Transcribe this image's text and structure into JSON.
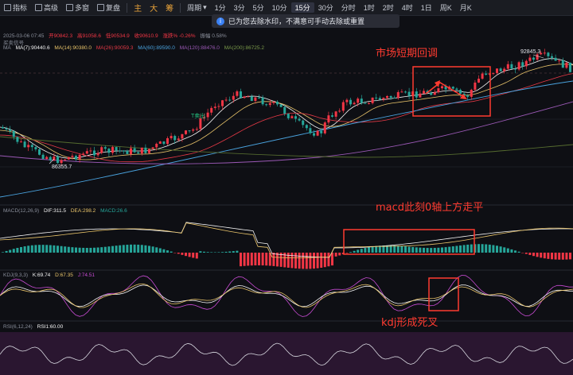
{
  "toolbar": {
    "indicator_label": "指标",
    "pro_label": "高级",
    "multi_label": "多窗",
    "replay_label": "复盘",
    "badges": [
      "主",
      "大",
      "筹"
    ],
    "period_label": "周期",
    "periods": [
      "1分",
      "3分",
      "5分",
      "10分",
      "15分",
      "30分",
      "分时",
      "1时",
      "2时",
      "4时",
      "1日",
      "周K",
      "月K"
    ],
    "active_period": "15分"
  },
  "toast": {
    "text": "已为您去除水印，不满意可手动去除或重置"
  },
  "header": {
    "datetime": "2025-03-06 07:45",
    "ohlc_open": "开90842.3",
    "ohlc_high": "高91058.6",
    "ohlc_low": "低90534.9",
    "ohlc_close": "收90610.9",
    "change": "涨跌 -235.3",
    "change_pct": "涨跌% -0.26%",
    "amplitude": "振幅 0.58%",
    "signal_label": "买卖信号"
  },
  "ma": {
    "name": "MA",
    "ma7": "MA(7):90440.6",
    "ma14": "MA(14):90380.0",
    "ma26": "MA(26):90059.3",
    "ma60": "MA(60):89590.0",
    "ma120": "MA(120):88476.0",
    "ma200": "MA(200):86725.2",
    "high_label": "92845.3",
    "low_label": "86355.7",
    "sell_label": "T卖出"
  },
  "macd": {
    "name": "MACD(12,26,9)",
    "dif": "DIF:311.5",
    "dea": "DEA:298.2",
    "macd": "MACD:26.6"
  },
  "kdj": {
    "name": "KDJ(9,3,3)",
    "k": "K:69.74",
    "d": "D:67.35",
    "j": "J:74.51"
  },
  "rsi": {
    "name": "RSI(6,12,24)",
    "rsi1": "RSI1:60.00"
  },
  "annotations": {
    "short_term": "市场短期回调",
    "macd_note": "macd此刻0轴上方走平",
    "kdj_note": "kdj形成死叉"
  },
  "colors": {
    "up": "#f23645",
    "down": "#26a69a",
    "annotation": "#ff3b30",
    "ma7": "#f5f5f5",
    "ma14": "#e9c46a",
    "ma26": "#e63946",
    "ma60": "#4aa3df",
    "ma120": "#9b59b6",
    "ma200": "#556b2f"
  }
}
